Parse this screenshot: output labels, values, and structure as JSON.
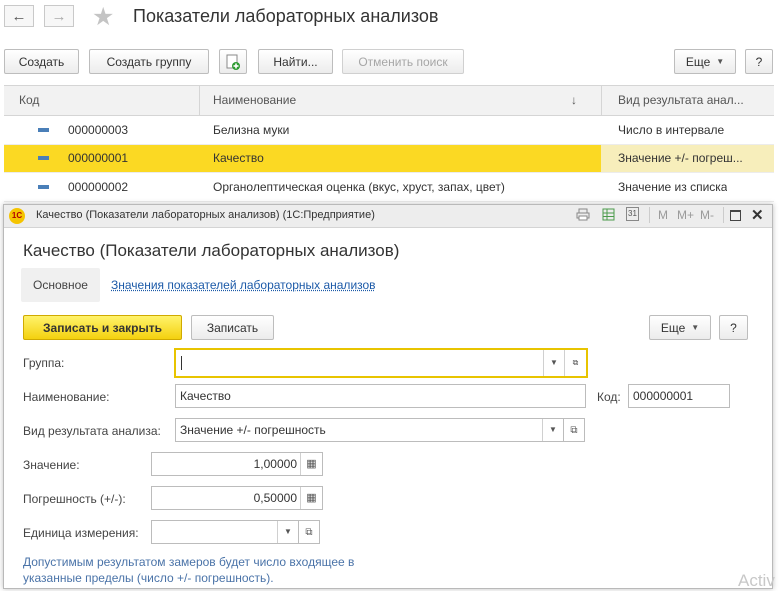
{
  "window": {
    "title": "Показатели лабораторных анализов"
  },
  "toolbar": {
    "create": "Создать",
    "create_group": "Создать группу",
    "find": "Найти...",
    "cancel_search": "Отменить поиск",
    "more": "Еще",
    "help": "?"
  },
  "table": {
    "headers": {
      "code": "Код",
      "name": "Наименование",
      "sort": "↓",
      "result_type": "Вид результата анал..."
    },
    "rows": [
      {
        "code": "000000003",
        "name": "Белизна муки",
        "result_type": "Число в интервале"
      },
      {
        "code": "000000001",
        "name": "Качество",
        "result_type": "Значение +/- погреш..."
      },
      {
        "code": "000000002",
        "name": "Органолептическая оценка (вкус, хруст, запах, цвет)",
        "result_type": "Значение из списка"
      }
    ]
  },
  "dialog": {
    "window_title": "Качество (Показатели лабораторных анализов) (1С:Предприятие)",
    "heading": "Качество (Показатели лабораторных анализов)",
    "tabs": {
      "main": "Основное",
      "values": "Значения показателей лабораторных анализов"
    },
    "buttons": {
      "save_close": "Записать и закрыть",
      "save": "Записать",
      "more": "Еще",
      "help": "?"
    },
    "fields": {
      "group_label": "Группа:",
      "group_value": "",
      "name_label": "Наименование:",
      "name_value": "Качество",
      "code_label": "Код:",
      "code_value": "000000001",
      "result_type_label": "Вид результата анализа:",
      "result_type_value": "Значение +/- погрешность",
      "value_label": "Значение:",
      "value_value": "1,00000",
      "error_label": "Погрешность (+/-):",
      "error_value": "0,50000",
      "unit_label": "Единица измерения:",
      "unit_value": ""
    },
    "note_line1": "Допустимым результатом замеров будет число входящее в",
    "note_line2": "указанные пределы (число +/- погрешность).",
    "title_icons": [
      "print-icon",
      "table-icon",
      "calendar-icon",
      "memory-m-icon",
      "memory-plus-icon",
      "memory-minus-icon",
      "maximize-icon",
      "close-icon"
    ],
    "title_icon_labels": {
      "m": "M",
      "mplus": "M+",
      "mminus": "M-",
      "calendar": "31"
    }
  },
  "watermark": "Activ",
  "colors": {
    "selection": "#fbd923",
    "primary_button": "#f4d10f",
    "link": "#1c5aa8",
    "note": "#4a73a8"
  }
}
